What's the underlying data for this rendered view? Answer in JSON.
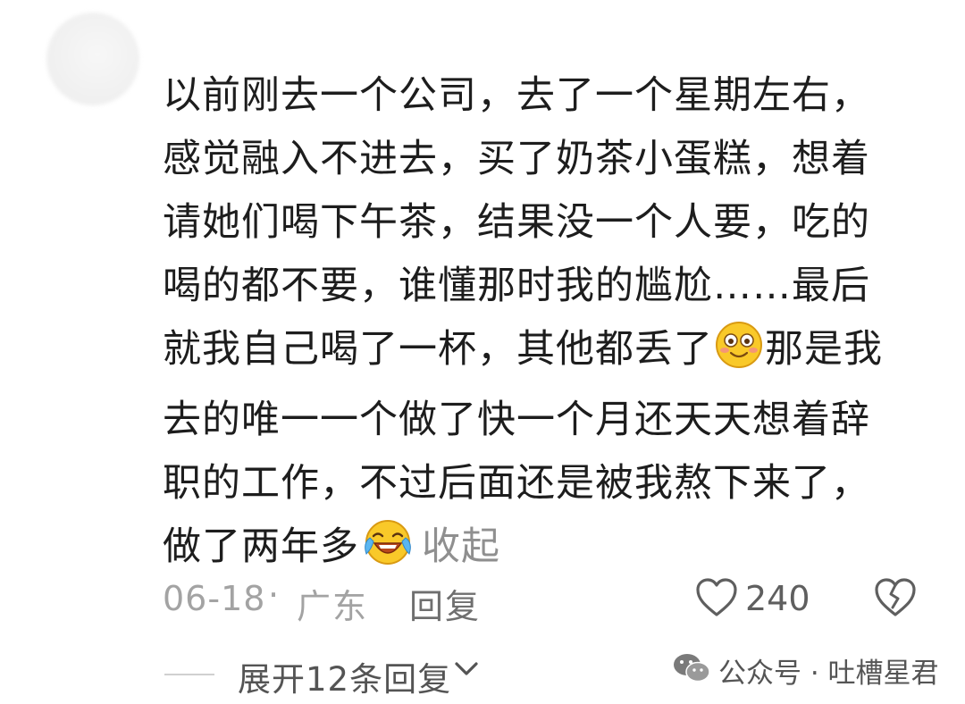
{
  "comment": {
    "lines": [
      "以前刚去一个公司，去了一个星期左右，",
      "感觉融入不进去，买了奶茶小蛋糕，想着",
      "请她们喝下午茶，结果没一个人要，吃的",
      "喝的都不要，谁懂那时我的尴尬……最后",
      "就我自己喝了一杯，其他都丢了",
      "那是我",
      "去的唯一一个做了快一个月还天天想着辞",
      "职的工作，不过后面还是被我熬下来了，",
      "做了两年多"
    ],
    "collapse_label": "收起",
    "emojis": [
      "smile-emoji",
      "laugh-cry-emoji"
    ]
  },
  "meta": {
    "date": "06-18",
    "separator": "·",
    "location": "广东",
    "reply_label": "回复",
    "like_count": "240"
  },
  "expand": {
    "label": "展开12条回复"
  },
  "watermark": {
    "text": "公众号 · 吐槽星君"
  },
  "icons": {
    "like": "heart-outline-icon",
    "dislike": "broken-heart-icon",
    "expand": "chevron-down-icon",
    "watermark": "wechat-logo-icon"
  },
  "colors": {
    "text": "#1d1d1d",
    "muted": "#a3a3a3",
    "reply": "#6f6f6f",
    "emoji_face": "#f9c929"
  }
}
